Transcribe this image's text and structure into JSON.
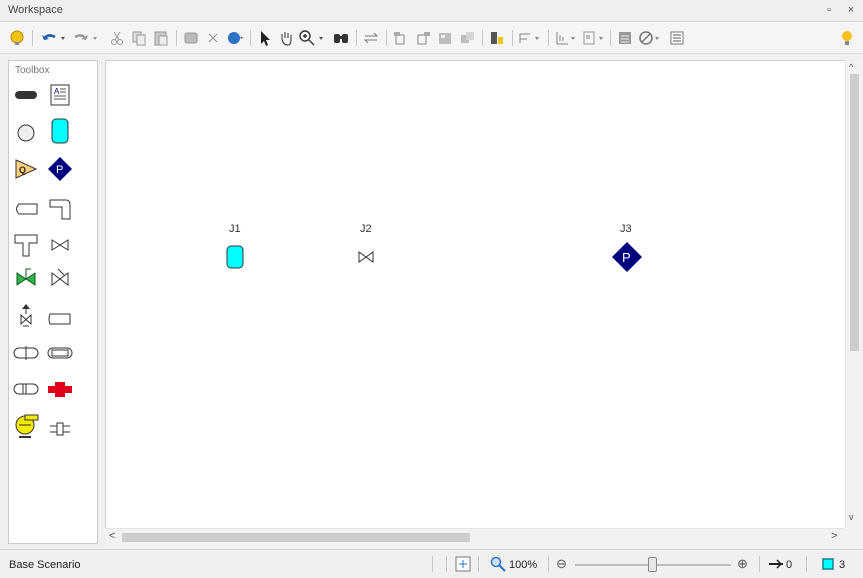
{
  "window": {
    "title": "Workspace",
    "restore_icon": "restore-icon",
    "close_icon": "close-icon"
  },
  "toolbar": {
    "icons": [
      "help-icon",
      "undo-icon",
      "undo-dropdown-icon",
      "redo-icon",
      "redo-dropdown-icon",
      "cut-icon",
      "copy-icon",
      "paste-icon",
      "select-all-icon",
      "delete-icon",
      "globe-icon",
      "pointer-icon",
      "hand-pan-icon",
      "zoom-in-icon",
      "zoom-dropdown-icon",
      "find-icon",
      "reverse-icon",
      "bring-front-icon",
      "send-back-icon",
      "group-icon",
      "ungroup-icon",
      "color-icon",
      "align-icon",
      "distribute-icon",
      "grid-icon",
      "no-annotation-icon",
      "properties-icon",
      "hint-lightbulb-icon"
    ]
  },
  "toolbox": {
    "header": "Toolbox",
    "items": [
      "pipe-tool-icon",
      "annotation-tool-icon",
      "branch-tool-icon",
      "reservoir-tool-icon",
      "assigned-flow-tool-icon",
      "assigned-pressure-tool-icon",
      "dead-end-tool-icon",
      "bend-tool-icon",
      "tee-tool-icon",
      "valve-tool-icon",
      "control-valve-tool-icon",
      "check-valve-tool-icon",
      "relief-valve-tool-icon",
      "spray-tool-icon",
      "area-change-tool-icon",
      "heat-exchanger-tool-icon",
      "screen-tool-icon",
      "general-component-tool-icon",
      "pump-tool-icon",
      "orifice-tool-icon"
    ]
  },
  "nodes": [
    {
      "label": "J1",
      "type": "reservoir",
      "icon": "reservoir-icon",
      "color": "#00ffff"
    },
    {
      "label": "J2",
      "type": "valve",
      "icon": "valve-icon"
    },
    {
      "label": "J3",
      "type": "assigned-pressure",
      "icon": "assigned-pressure-icon",
      "color": "#00007f",
      "glyph": "P"
    }
  ],
  "scrollbars": {
    "up": "^",
    "down": "v",
    "left": "<",
    "right": ">"
  },
  "status": {
    "scenario": "Base Scenario",
    "zoom": "100%",
    "zoom_minus": "⊖",
    "zoom_plus": "⊕",
    "pipe_count": "0",
    "junction_count": "3"
  }
}
